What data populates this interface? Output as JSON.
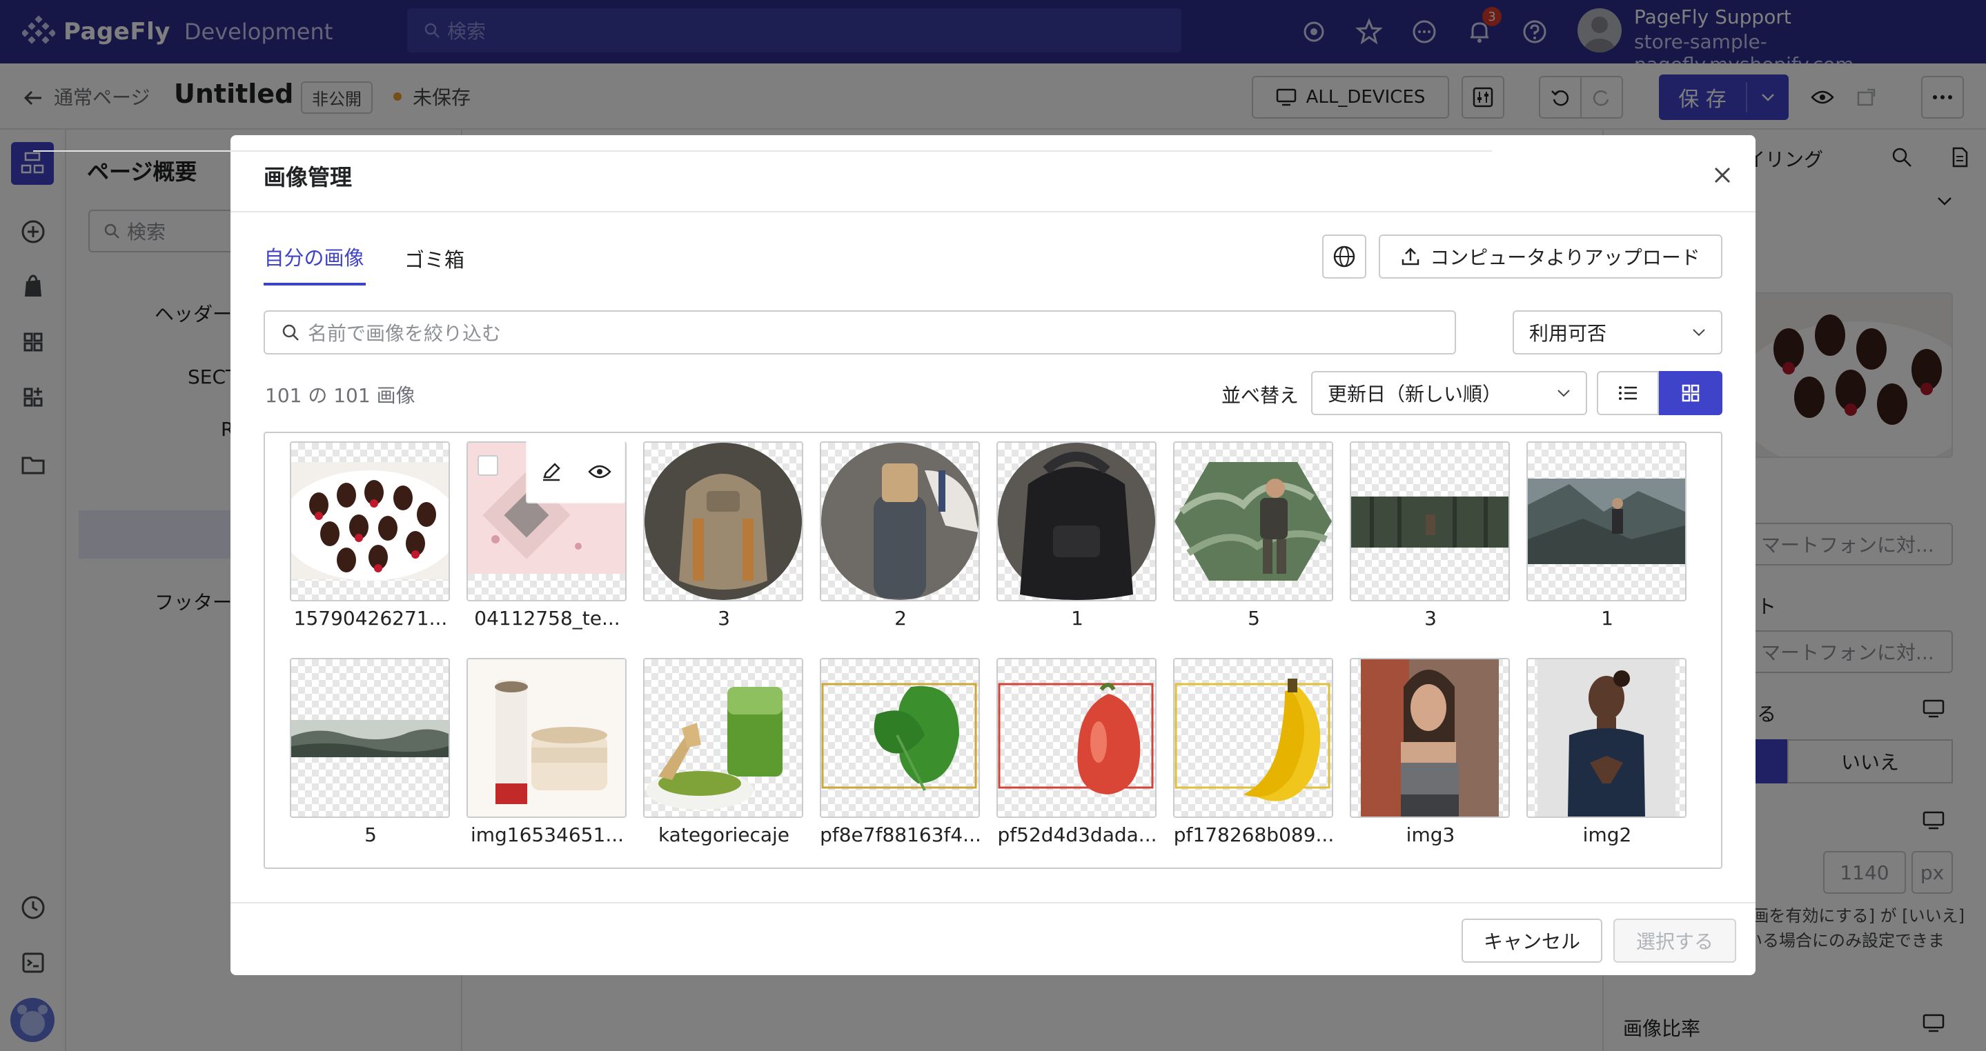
{
  "app": {
    "brand": "PageFly",
    "env": "Development",
    "search_placeholder": "検索",
    "notification_count": "3",
    "user_name": "PageFly Support",
    "store_domain": "store-sample-pagefly.myshopify.com"
  },
  "page_header": {
    "breadcrumb": "通常ページ",
    "title": "Untitled",
    "visibility_badge": "非公開",
    "save_state": "未保存",
    "devices_label": "ALL_DEVICES",
    "save_label": "保 存"
  },
  "layers_panel": {
    "title": "ページ概要",
    "search_placeholder": "検索",
    "rows": [
      "ヘッダー",
      "SECT",
      "R",
      "フッター"
    ]
  },
  "settings_panel": {
    "tab_label": "イリング",
    "input1": "マートフォンに対...",
    "label2": "ト",
    "input2": "マートフォンに対...",
    "label3": "る",
    "toggle_no": "いいえ",
    "width_value": "1140",
    "width_unit": "px",
    "note": "[画を有効にする] が [いいえ] いる場合にのみ設定できま",
    "ratio_label": "画像比率"
  },
  "modal": {
    "title": "画像管理",
    "tabs": [
      "自分の画像",
      "ゴミ箱"
    ],
    "upload_label": "コンピュータよりアップロード",
    "filter_placeholder": "名前で画像を絞り込む",
    "availability": "利用可否",
    "count_text": "101 の 101 画像",
    "sort_label": "並べ替え",
    "sort_value": "更新日（新しい順）",
    "cancel_label": "キャンセル",
    "select_label": "選択する",
    "images": [
      {
        "name": "15790426271...",
        "kind": "strawberries"
      },
      {
        "name": "04112758_te...",
        "kind": "pink-product"
      },
      {
        "name": "3",
        "kind": "backpack-circle"
      },
      {
        "name": "2",
        "kind": "bottle-circle"
      },
      {
        "name": "1",
        "kind": "black-bag-circle"
      },
      {
        "name": "5",
        "kind": "hiker-hexagon"
      },
      {
        "name": "3",
        "kind": "forest-strip"
      },
      {
        "name": "1",
        "kind": "mountain-hiker"
      },
      {
        "name": "5",
        "kind": "fog-strip"
      },
      {
        "name": "img16534651...",
        "kind": "cosmetics"
      },
      {
        "name": "kategoriecaje",
        "kind": "matcha"
      },
      {
        "name": "pf8e7f88163f4...",
        "kind": "spinach"
      },
      {
        "name": "pf52d4d3dada...",
        "kind": "pepper"
      },
      {
        "name": "pf178268b089...",
        "kind": "banana"
      },
      {
        "name": "img3",
        "kind": "woman-sport"
      },
      {
        "name": "img2",
        "kind": "woman-yoga"
      }
    ]
  },
  "colors": {
    "brand_bar": "#2c2d8f",
    "accent": "#3f43c9",
    "overlay": "rgba(0,0,0,0.5)"
  }
}
